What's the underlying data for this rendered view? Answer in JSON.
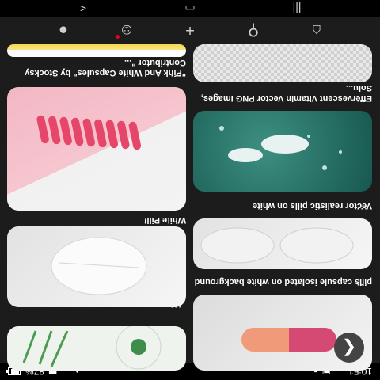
{
  "status_bar": {
    "time": "10:51",
    "battery": "87%",
    "battery_level": 0.87
  },
  "cards": [
    {
      "caption": "pills capsule isolated on white background"
    },
    {
      "caption": "Vector realistic pills on white"
    },
    {
      "caption": "Effervescent Vitamin Vector PNG Images, Solu..."
    },
    {
      "caption": "White Pill!"
    },
    {
      "caption": "\"Pink And White Capsules\" by Stocksy Contributor \"..."
    }
  ],
  "more_label": "...",
  "fab_icon": "chevron-right-icon",
  "tabs": [
    {
      "icon": "home-icon"
    },
    {
      "icon": "search-icon"
    },
    {
      "icon": "add-icon"
    },
    {
      "icon": "notifications-icon"
    },
    {
      "icon": "profile-icon"
    }
  ],
  "nav": [
    {
      "icon": "back-icon"
    },
    {
      "icon": "home-button-icon"
    },
    {
      "icon": "recents-icon"
    }
  ],
  "colors": {
    "background": "#1c1c1c",
    "accent_red": "#e60023"
  }
}
